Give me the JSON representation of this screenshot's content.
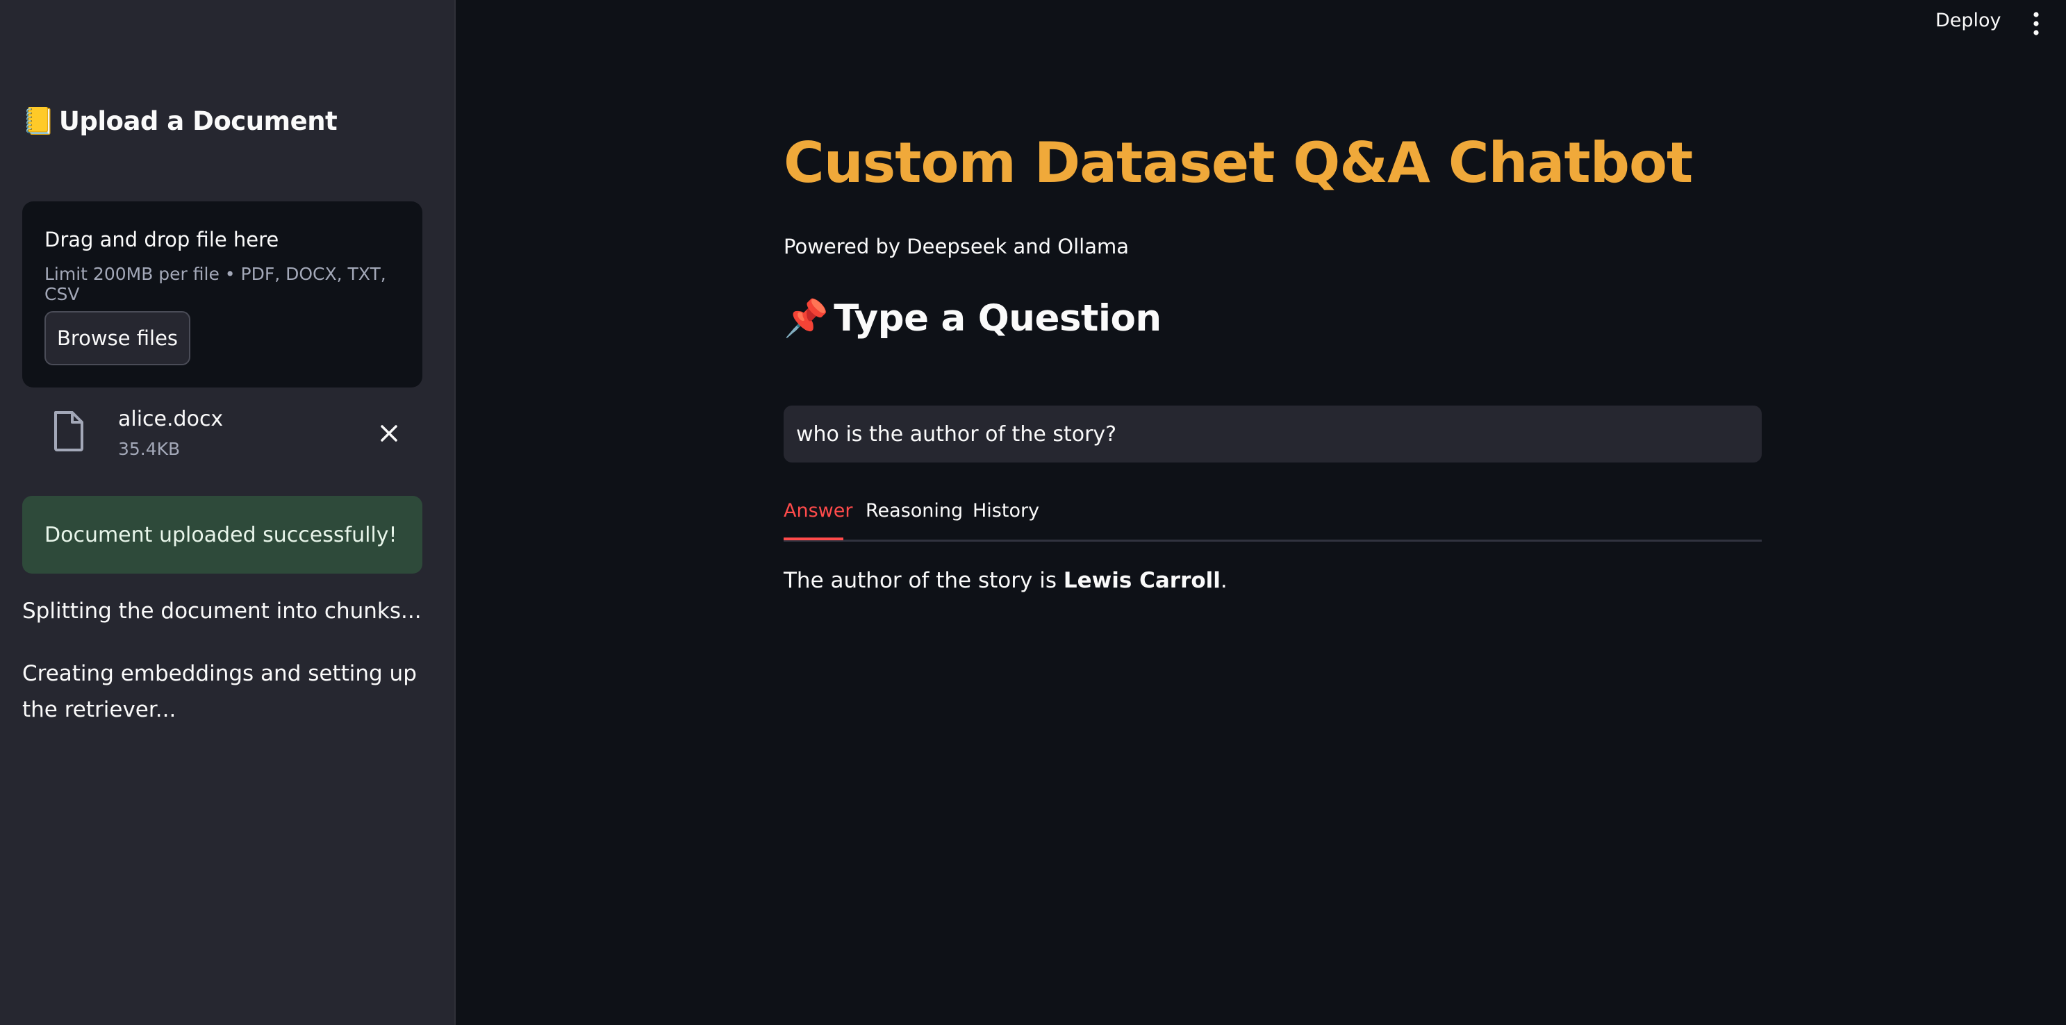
{
  "toolbar": {
    "deploy_label": "Deploy",
    "menu_icon": "more-vertical-icon"
  },
  "sidebar": {
    "header_emoji": "📒",
    "header_text": "Upload a Document",
    "uploader": {
      "drag_text": "Drag and drop file here",
      "limit_text": "Limit 200MB per file • PDF, DOCX, TXT, CSV",
      "browse_label": "Browse files"
    },
    "file": {
      "icon": "file-icon",
      "name": "alice.docx",
      "size": "35.4KB",
      "remove_icon": "close-icon"
    },
    "success_message": "Document uploaded successfully!",
    "status_split": "Splitting the document into chunks...",
    "status_embed": "Creating embeddings and setting up the retriever..."
  },
  "main": {
    "title": "Custom Dataset Q&A Chatbot",
    "subtitle": "Powered by Deepseek and Ollama",
    "section_emoji": "📌",
    "section_title": "Type a Question",
    "question_value": "who is the author of the story?",
    "tabs": [
      {
        "label": "Answer",
        "active": true
      },
      {
        "label": "Reasoning",
        "active": false
      },
      {
        "label": "History",
        "active": false
      }
    ],
    "answer": {
      "prefix": "The author of the story is ",
      "bold": "Lewis Carroll",
      "suffix": "."
    }
  },
  "colors": {
    "background": "#0e1117",
    "sidebar": "#262730",
    "title": "#f0a93a",
    "accent": "#ff4b4b",
    "success_bg": "#2e4a3a"
  }
}
